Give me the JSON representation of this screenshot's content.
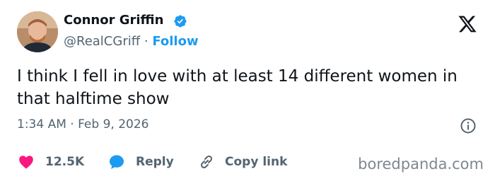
{
  "tweet": {
    "author_name": "Connor Griffin",
    "handle": "@RealCGriff",
    "separator": "·",
    "follow_label": "Follow",
    "text": "I think I fell in love with at least 14 different women in that halftime show",
    "timestamp": "1:34 AM · Feb 9, 2026",
    "likes": "12.5K",
    "reply_label": "Reply",
    "copy_link_label": "Copy link"
  },
  "icons": {
    "verified": "verified-badge-icon",
    "platform": "x-logo-icon",
    "info": "info-icon",
    "like": "heart-icon",
    "reply": "reply-bubble-icon",
    "copy": "link-icon"
  },
  "colors": {
    "accent": "#1d9bf0",
    "like": "#f91880",
    "text": "#0f1419",
    "secondary": "#536471"
  },
  "watermark": "boredpanda.com"
}
